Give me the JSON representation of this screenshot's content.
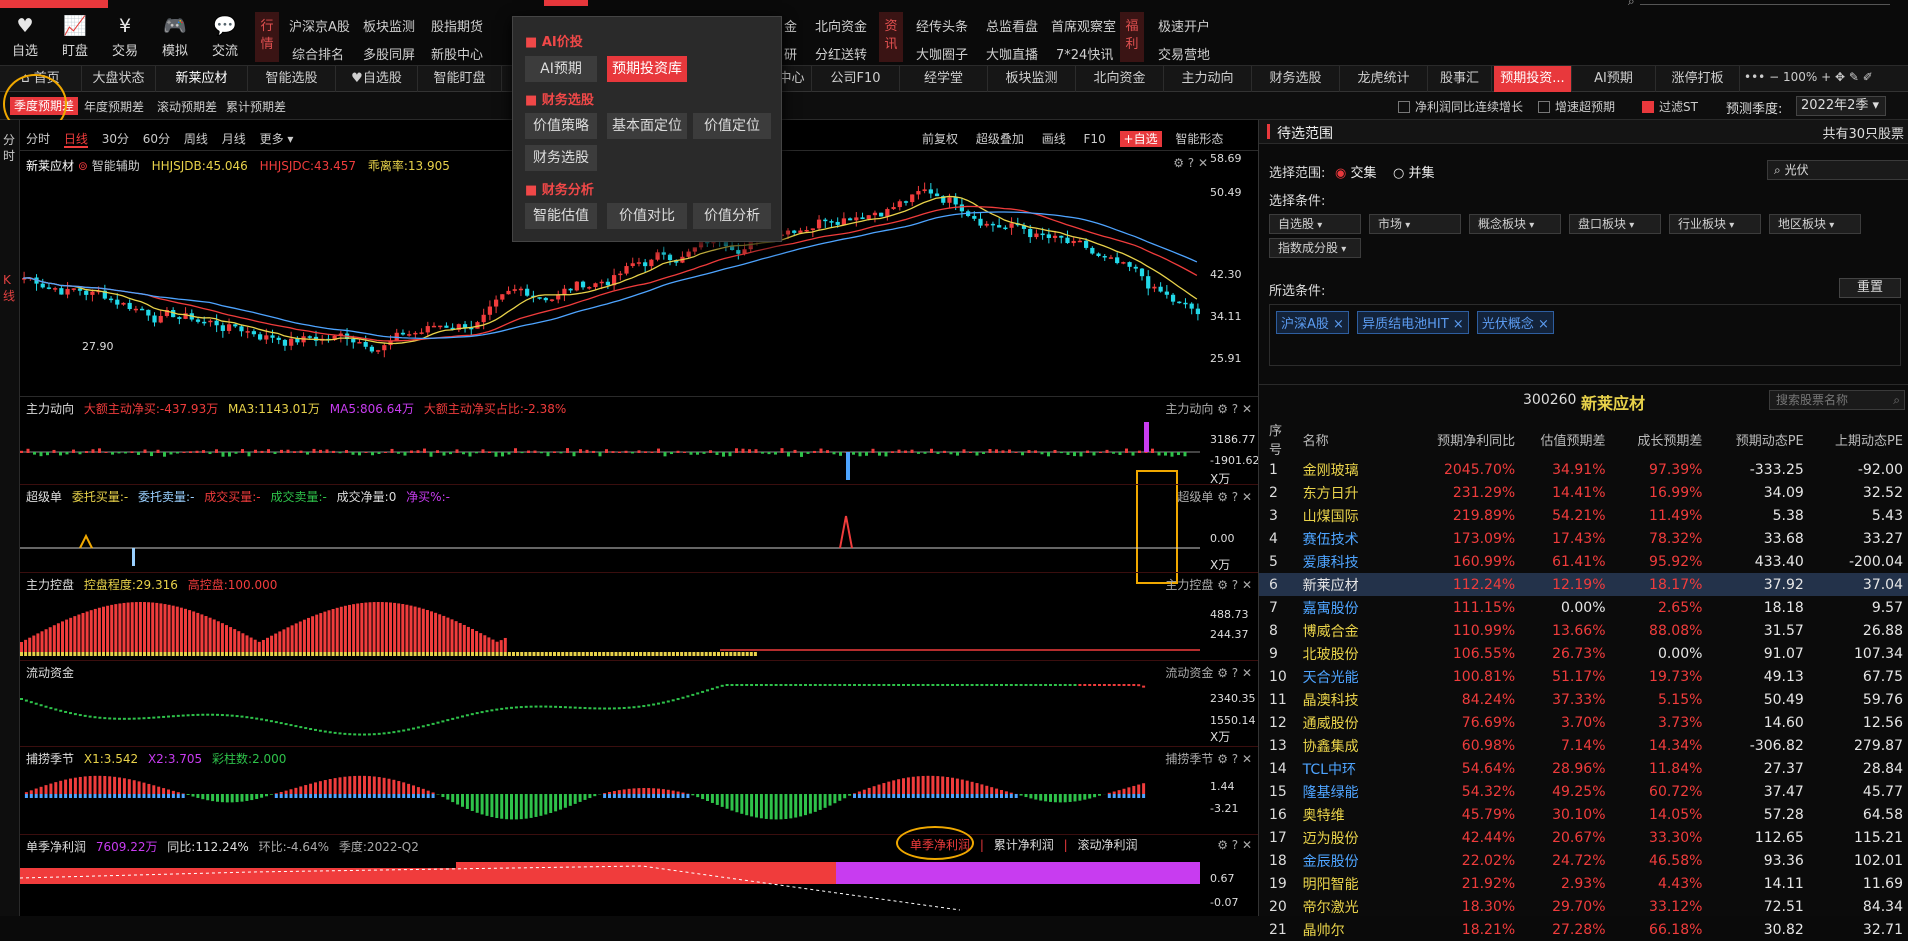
{
  "top": {
    "buttons": [
      {
        "label": "自选",
        "icon": "heart-icon"
      },
      {
        "label": "盯盘",
        "icon": "chart-icon"
      },
      {
        "label": "交易",
        "icon": "yen-icon"
      },
      {
        "label": "模拟",
        "icon": "gamepad-icon"
      },
      {
        "label": "交流",
        "icon": "chat-icon"
      }
    ],
    "hang_tag": "行情",
    "hang_row1": [
      "沪深京A股",
      "板块监测",
      "股指期货"
    ],
    "hang_row2": [
      "综合排名",
      "多股同屏",
      "新股中心"
    ],
    "mid_row1": [
      "金",
      "北向资金"
    ],
    "mid_row2": [
      "研",
      "分红送转"
    ],
    "zx_tag": "资讯",
    "zx_row1": [
      "经传头条",
      "总监看盘",
      "首席观察室"
    ],
    "zx_row2": [
      "大咖圈子",
      "大咖直播",
      "7*24快讯"
    ],
    "fl_tag": "福利",
    "fl_row1": [
      "极速开户"
    ],
    "fl_row2": [
      "交易营地"
    ]
  },
  "tabs": [
    "首页",
    "大盘状态",
    "新莱应材",
    "智能选股",
    "自选股",
    "智能盯盘",
    "中心",
    "公司F10",
    "经学堂",
    "板块监测",
    "北向资金",
    "主力动向",
    "财务选股",
    "龙虎统计",
    "股事汇",
    "预期投资...",
    "AI预期",
    "涨停打板"
  ],
  "zoom": "100%",
  "subrow": {
    "tabs": [
      "季度预期差",
      "年度预期差",
      "滚动预期差",
      "累计预期差"
    ],
    "checks": [
      {
        "label": "净利润同比连续增长",
        "on": false
      },
      {
        "label": "增速超预期",
        "on": false
      },
      {
        "label": "过滤ST",
        "on": true
      }
    ],
    "season_label": "预测季度:",
    "season_value": "2022年2季"
  },
  "leftstrip": {
    "a": "分时",
    "b": "K线"
  },
  "chart": {
    "periods": [
      "分时",
      "日线",
      "30分",
      "60分",
      "周线",
      "月线",
      "更多"
    ],
    "right_tools": [
      "前复权",
      "超级叠加",
      "画线",
      "F10",
      "+自选",
      "智能形态"
    ],
    "stock_name": "新莱应材",
    "assist": "智能辅助",
    "hhjsjdb": "HHJSJDB:45.046",
    "hhjsjdc": "HHJSJDC:43.457",
    "lilv": "乖离率:13.905",
    "y_labels": [
      "58.69",
      "50.49",
      "42.30",
      "34.11",
      "25.91"
    ],
    "low_label": "27.90",
    "panels": {
      "zldx": {
        "name": "主力动向",
        "v1": "大额主动净买:-437.93万",
        "v2": "MA3:1143.01万",
        "v3": "MA5:806.64万",
        "v4": "大额主动净买占比:-2.38%",
        "ax1": "3186.77",
        "ax2": "-1901.62",
        "unit": "X万"
      },
      "cjd": {
        "name": "超级单",
        "v1": "委托买量:-",
        "v2": "委托卖量:-",
        "v3": "成交买量:-",
        "v4": "成交卖量:-",
        "v5": "成交净量:0",
        "v6": "净买%:-",
        "ax1": "0.00",
        "unit": "X万"
      },
      "zlkp": {
        "name": "主力控盘",
        "v1": "控盘程度:29.316",
        "v2": "高控盘:100.000",
        "ax1": "488.73",
        "ax2": "244.37"
      },
      "ldzj": {
        "name": "流动资金",
        "ax1": "2340.35",
        "ax2": "1550.14",
        "unit": "X万"
      },
      "blj": {
        "name": "捕捞季节",
        "v1": "X1:3.542",
        "v2": "X2:3.705",
        "v3": "彩柱数:2.000",
        "ax1": "1.44",
        "ax2": "-3.21"
      },
      "djl": {
        "name": "单季净利润",
        "v1": "7609.22万",
        "v2": "同比:112.24%",
        "v3": "环比:-4.64%",
        "v4": "季度:2022-Q2",
        "t1": "单季净利润",
        "t2": "累计净利润",
        "t3": "滚动净利润",
        "ax1": "0.67",
        "ax2": "-0.07"
      }
    }
  },
  "menu": {
    "h1": "AI价投",
    "b_ai": "AI预期",
    "b_yq": "预期投资库",
    "h2": "财务选股",
    "b1": "价值策略",
    "b2": "基本面定位",
    "b3": "价值定位",
    "b4": "财务选股",
    "h3": "财务分析",
    "b5": "智能估值",
    "b6": "价值对比",
    "b7": "价值分析"
  },
  "right": {
    "title": "待选范围",
    "count": "共有30只股票",
    "range_label": "选择范围:",
    "r1": "交集",
    "r2": "并集",
    "search_value": "光伏",
    "cond_label": "选择条件:",
    "selects": [
      "自选股",
      "市场",
      "概念板块",
      "盘口板块",
      "行业板块",
      "地区板块",
      "指数成分股"
    ],
    "chosen_label": "所选条件:",
    "reset": "重置",
    "chips": [
      "沪深A股",
      "异质结电池HIT",
      "光伏概念"
    ],
    "stock_code": "300260",
    "stock_name": "新莱应材",
    "search_placeholder": "搜索股票名称",
    "columns": [
      "序号",
      "名称",
      "预期净利同比",
      "估值预期差",
      "成长预期差",
      "预期动态PE",
      "上期动态PE"
    ],
    "rows": [
      [
        "1",
        "金刚玻璃",
        "2045.70%",
        "34.91%",
        "97.39%",
        "-333.25",
        "-92.00"
      ],
      [
        "2",
        "东方日升",
        "231.29%",
        "14.41%",
        "16.99%",
        "34.09",
        "32.52"
      ],
      [
        "3",
        "山煤国际",
        "219.89%",
        "54.21%",
        "11.49%",
        "5.38",
        "5.43"
      ],
      [
        "4",
        "赛伍技术",
        "173.09%",
        "17.43%",
        "78.32%",
        "33.68",
        "33.27"
      ],
      [
        "5",
        "爱康科技",
        "160.99%",
        "61.41%",
        "95.92%",
        "433.40",
        "-200.04"
      ],
      [
        "6",
        "新莱应材",
        "112.24%",
        "12.19%",
        "18.17%",
        "37.92",
        "37.04"
      ],
      [
        "7",
        "嘉寓股份",
        "111.15%",
        "0.00%",
        "2.65%",
        "18.18",
        "9.57"
      ],
      [
        "8",
        "博威合金",
        "110.99%",
        "13.66%",
        "88.08%",
        "31.57",
        "26.88"
      ],
      [
        "9",
        "北玻股份",
        "106.55%",
        "26.73%",
        "0.00%",
        "91.07",
        "107.34"
      ],
      [
        "10",
        "天合光能",
        "100.81%",
        "51.17%",
        "19.73%",
        "49.13",
        "67.75"
      ],
      [
        "11",
        "晶澳科技",
        "84.24%",
        "37.33%",
        "5.15%",
        "50.49",
        "59.76"
      ],
      [
        "12",
        "通威股份",
        "76.69%",
        "3.70%",
        "3.73%",
        "14.60",
        "12.56"
      ],
      [
        "13",
        "协鑫集成",
        "60.98%",
        "7.14%",
        "14.34%",
        "-306.82",
        "279.87"
      ],
      [
        "14",
        "TCL中环",
        "54.64%",
        "28.96%",
        "11.84%",
        "27.37",
        "28.84"
      ],
      [
        "15",
        "隆基绿能",
        "54.32%",
        "49.25%",
        "60.72%",
        "37.47",
        "45.77"
      ],
      [
        "16",
        "奥特维",
        "45.79%",
        "30.10%",
        "14.05%",
        "57.28",
        "64.58"
      ],
      [
        "17",
        "迈为股份",
        "42.44%",
        "20.67%",
        "33.30%",
        "112.65",
        "115.21"
      ],
      [
        "18",
        "金辰股份",
        "22.02%",
        "24.72%",
        "46.58%",
        "93.36",
        "102.01"
      ],
      [
        "19",
        "明阳智能",
        "21.92%",
        "2.93%",
        "4.43%",
        "14.11",
        "11.69"
      ],
      [
        "20",
        "帝尔激光",
        "18.30%",
        "29.70%",
        "33.12%",
        "72.51",
        "84.34"
      ],
      [
        "21",
        "晶帅尔",
        "18.21%",
        "27.28%",
        "66.18%",
        "30.82",
        "32.71"
      ]
    ],
    "name_colors": [
      "y",
      "y",
      "y",
      "b",
      "b",
      "w",
      "b",
      "y",
      "y",
      "b",
      "y",
      "y",
      "y",
      "b",
      "b",
      "y",
      "y",
      "b",
      "y",
      "y",
      "y"
    ],
    "col3_colors": [
      "r",
      "r",
      "r",
      "r",
      "r",
      "r",
      "r",
      "r",
      "r",
      "r",
      "r",
      "r",
      "r",
      "r",
      "r",
      "r",
      "r",
      "r",
      "r",
      "r",
      "r"
    ],
    "col4_colors": [
      "r",
      "r",
      "r",
      "r",
      "r",
      "r",
      "w",
      "r",
      "r",
      "r",
      "r",
      "r",
      "r",
      "r",
      "r",
      "r",
      "r",
      "r",
      "r",
      "r",
      "r"
    ],
    "col5_colors": [
      "r",
      "r",
      "r",
      "r",
      "r",
      "r",
      "r",
      "r",
      "w",
      "r",
      "r",
      "r",
      "r",
      "r",
      "r",
      "r",
      "r",
      "r",
      "r",
      "r",
      "r"
    ]
  },
  "colors": {
    "accent": "#e8383c",
    "up": "#f03c3c",
    "down": "#2ec24a",
    "cyan": "#22d8e8",
    "yellow": "#e8d24a",
    "purple": "#c83cf0",
    "highlight": "#f0a800"
  }
}
